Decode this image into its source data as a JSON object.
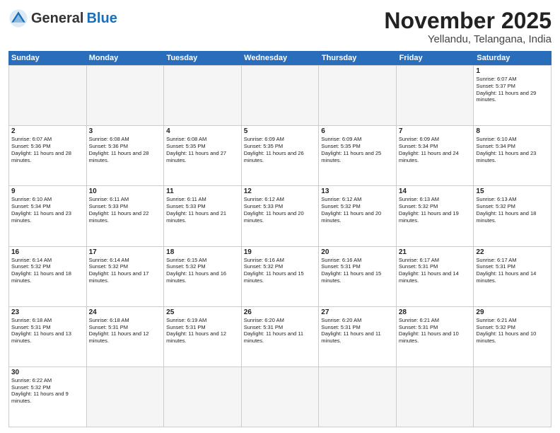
{
  "logo": {
    "text_general": "General",
    "text_blue": "Blue"
  },
  "header": {
    "month_title": "November 2025",
    "location": "Yellandu, Telangana, India"
  },
  "day_headers": [
    "Sunday",
    "Monday",
    "Tuesday",
    "Wednesday",
    "Thursday",
    "Friday",
    "Saturday"
  ],
  "rows": [
    [
      {
        "date": "",
        "empty": true
      },
      {
        "date": "",
        "empty": true
      },
      {
        "date": "",
        "empty": true
      },
      {
        "date": "",
        "empty": true
      },
      {
        "date": "",
        "empty": true
      },
      {
        "date": "",
        "empty": true
      },
      {
        "date": "1",
        "sunrise": "Sunrise: 6:07 AM",
        "sunset": "Sunset: 5:37 PM",
        "daylight": "Daylight: 11 hours and 29 minutes."
      }
    ],
    [
      {
        "date": "2",
        "sunrise": "Sunrise: 6:07 AM",
        "sunset": "Sunset: 5:36 PM",
        "daylight": "Daylight: 11 hours and 28 minutes."
      },
      {
        "date": "3",
        "sunrise": "Sunrise: 6:08 AM",
        "sunset": "Sunset: 5:36 PM",
        "daylight": "Daylight: 11 hours and 28 minutes."
      },
      {
        "date": "4",
        "sunrise": "Sunrise: 6:08 AM",
        "sunset": "Sunset: 5:35 PM",
        "daylight": "Daylight: 11 hours and 27 minutes."
      },
      {
        "date": "5",
        "sunrise": "Sunrise: 6:09 AM",
        "sunset": "Sunset: 5:35 PM",
        "daylight": "Daylight: 11 hours and 26 minutes."
      },
      {
        "date": "6",
        "sunrise": "Sunrise: 6:09 AM",
        "sunset": "Sunset: 5:35 PM",
        "daylight": "Daylight: 11 hours and 25 minutes."
      },
      {
        "date": "7",
        "sunrise": "Sunrise: 6:09 AM",
        "sunset": "Sunset: 5:34 PM",
        "daylight": "Daylight: 11 hours and 24 minutes."
      },
      {
        "date": "8",
        "sunrise": "Sunrise: 6:10 AM",
        "sunset": "Sunset: 5:34 PM",
        "daylight": "Daylight: 11 hours and 23 minutes."
      }
    ],
    [
      {
        "date": "9",
        "sunrise": "Sunrise: 6:10 AM",
        "sunset": "Sunset: 5:34 PM",
        "daylight": "Daylight: 11 hours and 23 minutes."
      },
      {
        "date": "10",
        "sunrise": "Sunrise: 6:11 AM",
        "sunset": "Sunset: 5:33 PM",
        "daylight": "Daylight: 11 hours and 22 minutes."
      },
      {
        "date": "11",
        "sunrise": "Sunrise: 6:11 AM",
        "sunset": "Sunset: 5:33 PM",
        "daylight": "Daylight: 11 hours and 21 minutes."
      },
      {
        "date": "12",
        "sunrise": "Sunrise: 6:12 AM",
        "sunset": "Sunset: 5:33 PM",
        "daylight": "Daylight: 11 hours and 20 minutes."
      },
      {
        "date": "13",
        "sunrise": "Sunrise: 6:12 AM",
        "sunset": "Sunset: 5:32 PM",
        "daylight": "Daylight: 11 hours and 20 minutes."
      },
      {
        "date": "14",
        "sunrise": "Sunrise: 6:13 AM",
        "sunset": "Sunset: 5:32 PM",
        "daylight": "Daylight: 11 hours and 19 minutes."
      },
      {
        "date": "15",
        "sunrise": "Sunrise: 6:13 AM",
        "sunset": "Sunset: 5:32 PM",
        "daylight": "Daylight: 11 hours and 18 minutes."
      }
    ],
    [
      {
        "date": "16",
        "sunrise": "Sunrise: 6:14 AM",
        "sunset": "Sunset: 5:32 PM",
        "daylight": "Daylight: 11 hours and 18 minutes."
      },
      {
        "date": "17",
        "sunrise": "Sunrise: 6:14 AM",
        "sunset": "Sunset: 5:32 PM",
        "daylight": "Daylight: 11 hours and 17 minutes."
      },
      {
        "date": "18",
        "sunrise": "Sunrise: 6:15 AM",
        "sunset": "Sunset: 5:32 PM",
        "daylight": "Daylight: 11 hours and 16 minutes."
      },
      {
        "date": "19",
        "sunrise": "Sunrise: 6:16 AM",
        "sunset": "Sunset: 5:32 PM",
        "daylight": "Daylight: 11 hours and 15 minutes."
      },
      {
        "date": "20",
        "sunrise": "Sunrise: 6:16 AM",
        "sunset": "Sunset: 5:31 PM",
        "daylight": "Daylight: 11 hours and 15 minutes."
      },
      {
        "date": "21",
        "sunrise": "Sunrise: 6:17 AM",
        "sunset": "Sunset: 5:31 PM",
        "daylight": "Daylight: 11 hours and 14 minutes."
      },
      {
        "date": "22",
        "sunrise": "Sunrise: 6:17 AM",
        "sunset": "Sunset: 5:31 PM",
        "daylight": "Daylight: 11 hours and 14 minutes."
      }
    ],
    [
      {
        "date": "23",
        "sunrise": "Sunrise: 6:18 AM",
        "sunset": "Sunset: 5:31 PM",
        "daylight": "Daylight: 11 hours and 13 minutes."
      },
      {
        "date": "24",
        "sunrise": "Sunrise: 6:18 AM",
        "sunset": "Sunset: 5:31 PM",
        "daylight": "Daylight: 11 hours and 12 minutes."
      },
      {
        "date": "25",
        "sunrise": "Sunrise: 6:19 AM",
        "sunset": "Sunset: 5:31 PM",
        "daylight": "Daylight: 11 hours and 12 minutes."
      },
      {
        "date": "26",
        "sunrise": "Sunrise: 6:20 AM",
        "sunset": "Sunset: 5:31 PM",
        "daylight": "Daylight: 11 hours and 11 minutes."
      },
      {
        "date": "27",
        "sunrise": "Sunrise: 6:20 AM",
        "sunset": "Sunset: 5:31 PM",
        "daylight": "Daylight: 11 hours and 11 minutes."
      },
      {
        "date": "28",
        "sunrise": "Sunrise: 6:21 AM",
        "sunset": "Sunset: 5:31 PM",
        "daylight": "Daylight: 11 hours and 10 minutes."
      },
      {
        "date": "29",
        "sunrise": "Sunrise: 6:21 AM",
        "sunset": "Sunset: 5:32 PM",
        "daylight": "Daylight: 11 hours and 10 minutes."
      }
    ],
    [
      {
        "date": "30",
        "sunrise": "Sunrise: 6:22 AM",
        "sunset": "Sunset: 5:32 PM",
        "daylight": "Daylight: 11 hours and 9 minutes."
      },
      {
        "date": "",
        "empty": true
      },
      {
        "date": "",
        "empty": true
      },
      {
        "date": "",
        "empty": true
      },
      {
        "date": "",
        "empty": true
      },
      {
        "date": "",
        "empty": true
      },
      {
        "date": "",
        "empty": true
      }
    ]
  ]
}
